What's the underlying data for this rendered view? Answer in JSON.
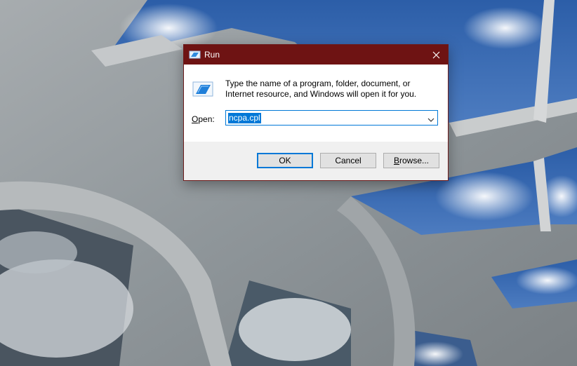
{
  "dialog": {
    "title": "Run",
    "close_symbol": "✕",
    "description": "Type the name of a program, folder, document, or Internet resource, and Windows will open it for you.",
    "open_label_access_key": "O",
    "open_label_rest": "pen:",
    "command_value": "ncpa.cpl",
    "buttons": {
      "ok": "OK",
      "cancel": "Cancel",
      "browse_access_key": "B",
      "browse_rest": "rowse..."
    }
  },
  "icons": {
    "title": "run-icon",
    "content": "run-icon",
    "close": "close-icon",
    "dropdown": "chevron-down-icon"
  },
  "colors": {
    "titlebar": "#6e1313",
    "accent": "#0078d7",
    "footer": "#f0f0f0"
  }
}
